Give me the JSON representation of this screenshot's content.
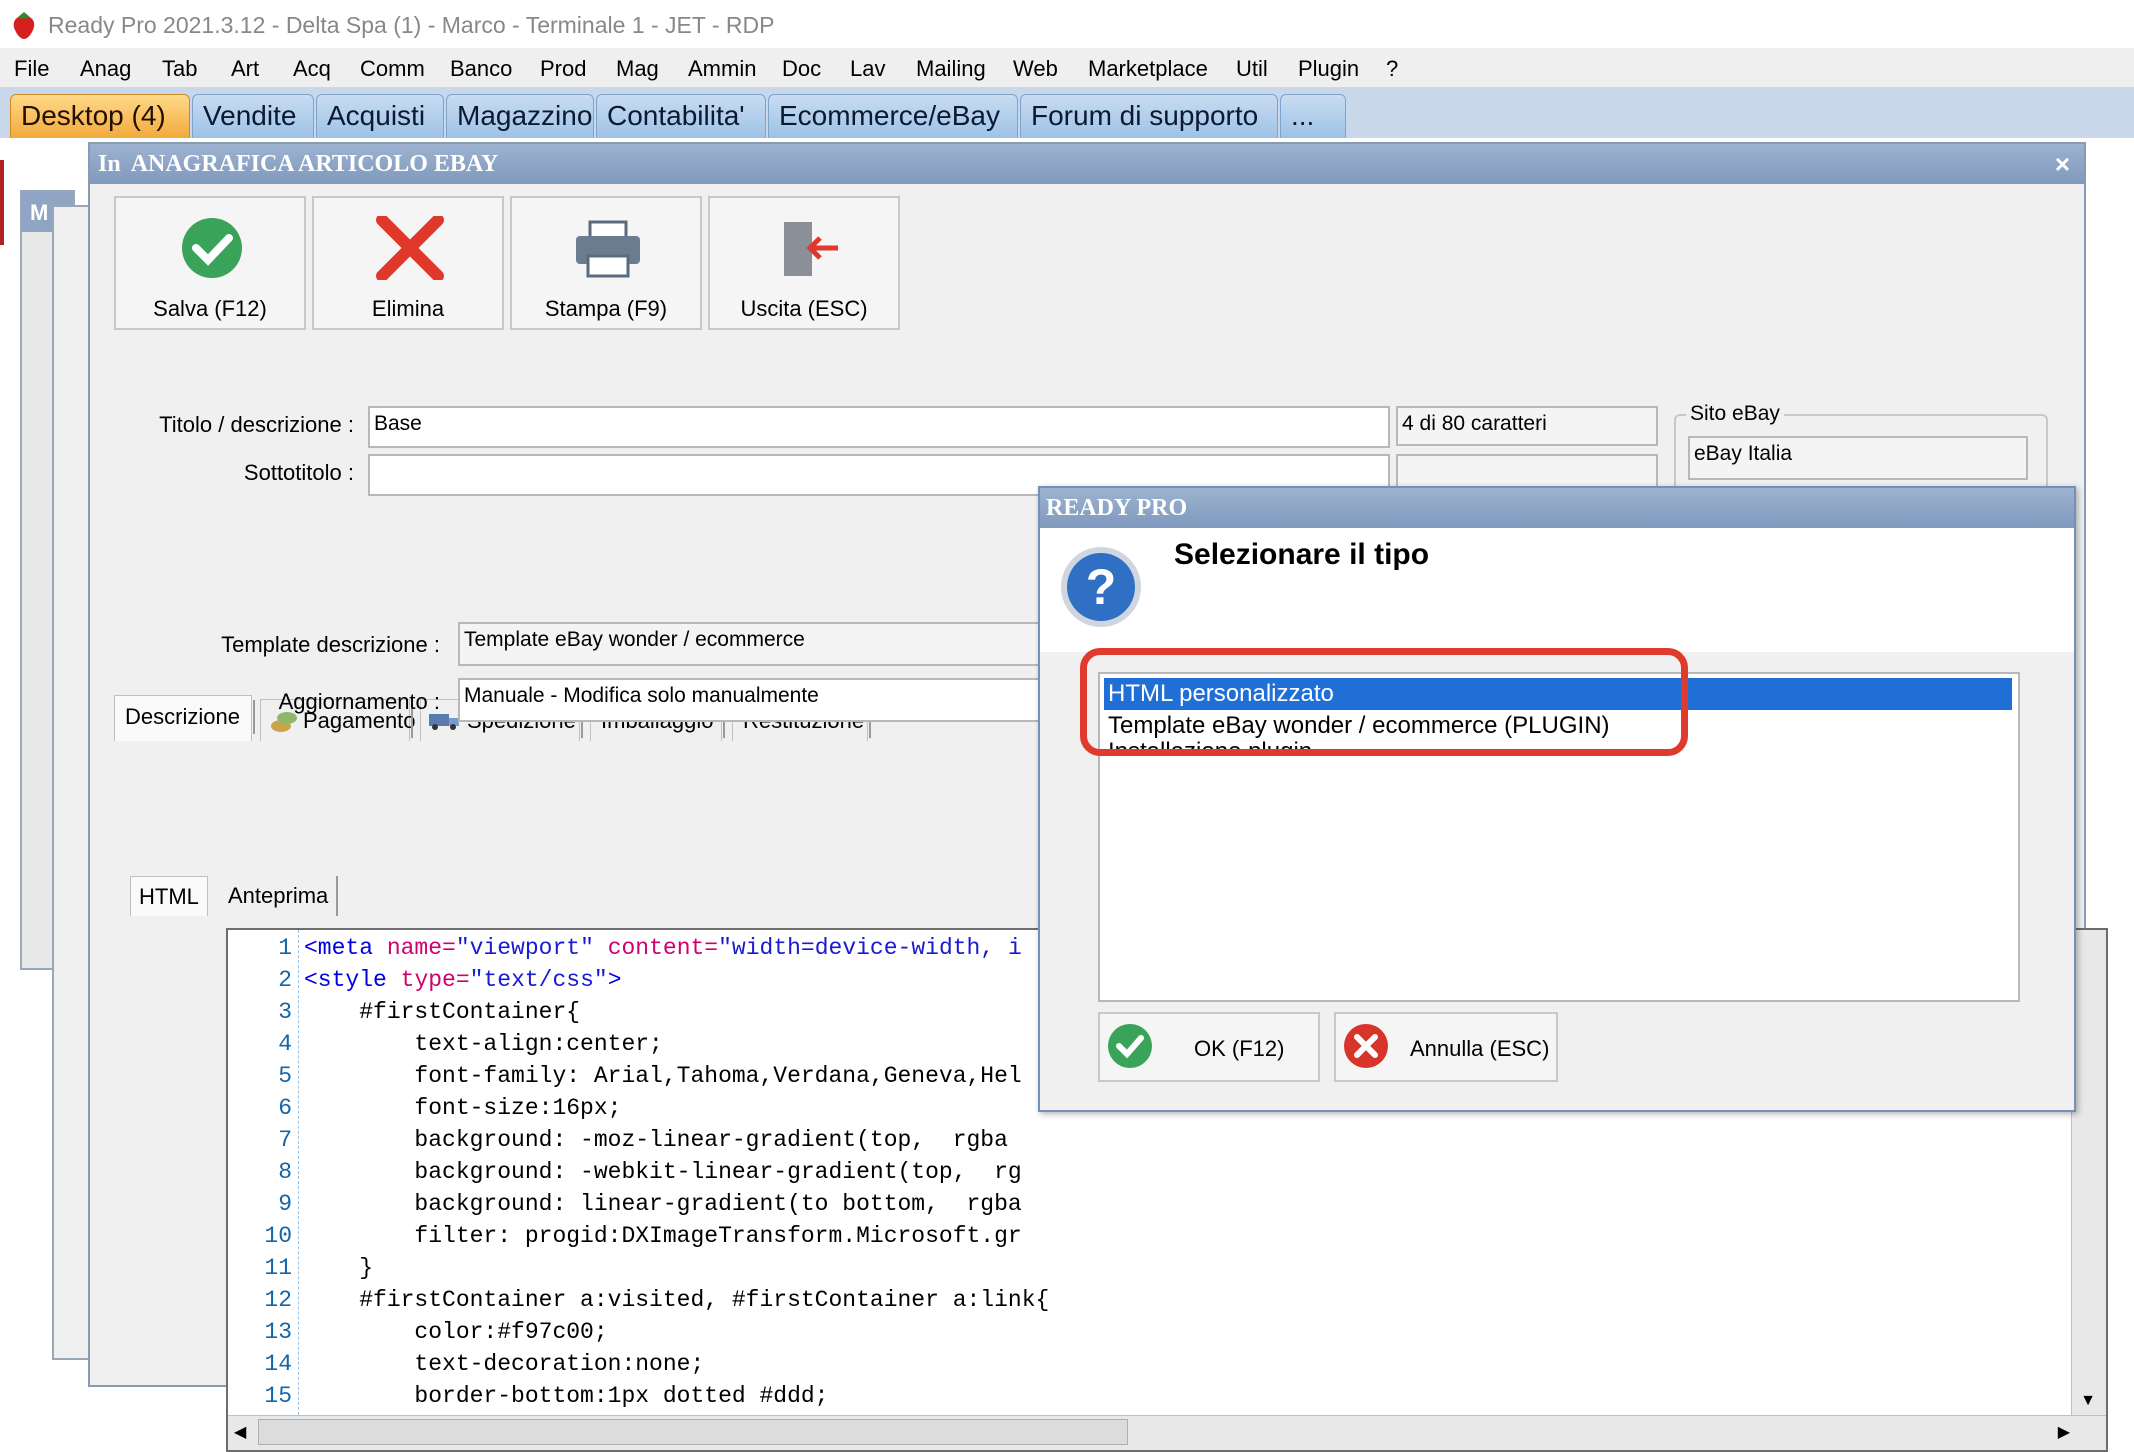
{
  "window": {
    "title": "Ready Pro 2021.3.12 - Delta Spa (1) - Marco - Terminale 1 - JET - RDP",
    "logo_icon": "strawberry-icon"
  },
  "menu": {
    "items": [
      "File",
      "Anag",
      "Tab",
      "Art",
      "Acq",
      "Comm",
      "Banco",
      "Prod",
      "Mag",
      "Ammin",
      "Doc",
      "Lav",
      "Mailing",
      "Web",
      "Marketplace",
      "Util",
      "Plugin",
      "?"
    ]
  },
  "desktop_tabs": {
    "items": [
      "Desktop (4)",
      "Vendite",
      "Acquisti",
      "Magazzino",
      "Contabilita'",
      "Ecommerce/eBay",
      "Forum di supporto",
      "..."
    ]
  },
  "background_windows": {
    "prefix_1": "In",
    "prefix_2": "M"
  },
  "article_window": {
    "title": "ANAGRAFICA ARTICOLO EBAY",
    "close_glyph": "×",
    "toolbar": {
      "save_label": "Salva (F12)",
      "delete_label": "Elimina",
      "print_label": "Stampa (F9)",
      "exit_label": "Uscita (ESC)"
    },
    "form": {
      "title_label": "Titolo / descrizione :",
      "title_value": "Base",
      "char_count": "4 di 80 caratteri",
      "subtitle_label": "Sottotitolo :",
      "subtitle_value": "",
      "site_group_label": "Sito eBay",
      "site_value": "eBay Italia"
    },
    "tabs": [
      "Descrizione",
      "Pagamento",
      "Spedizione",
      "Imballaggio",
      "Restituzione"
    ],
    "description": {
      "template_label": "Template descrizione :",
      "template_value": "Template eBay wonder / ecommerce",
      "update_label": "Aggiornamento :",
      "update_value": "Manuale - Modifica solo manualmente",
      "subtabs": [
        "HTML",
        "Anteprima"
      ]
    },
    "code_lines": [
      {
        "n": "1",
        "html": "<span class=\"tg\">&lt;meta</span> <span class=\"an\">name=</span><span class=\"av\">\"viewport\"</span> <span class=\"an\">content=</span><span class=\"av\">\"width=device-width, i</span>"
      },
      {
        "n": "2",
        "html": "<span class=\"tg\">&lt;style</span> <span class=\"an\">type=</span><span class=\"av\">\"text/css\"</span><span class=\"tg\">&gt;</span>"
      },
      {
        "n": "3",
        "html": "    #firstContainer{"
      },
      {
        "n": "4",
        "html": "        text-align:center;"
      },
      {
        "n": "5",
        "html": "        font-family: Arial,Tahoma,Verdana,Geneva,Hel"
      },
      {
        "n": "6",
        "html": "        font-size:16px;"
      },
      {
        "n": "7",
        "html": "        background: -moz-linear-gradient(top,  rgba"
      },
      {
        "n": "8",
        "html": "        background: -webkit-linear-gradient(top,  rg"
      },
      {
        "n": "9",
        "html": "        background: linear-gradient(to bottom,  rgba"
      },
      {
        "n": "10",
        "html": "        filter: progid:DXImageTransform.Microsoft.gr"
      },
      {
        "n": "11",
        "html": "    }"
      },
      {
        "n": "12",
        "html": "    #firstContainer a:visited, #firstContainer a:link{"
      },
      {
        "n": "13",
        "html": "        color:#f97c00;"
      },
      {
        "n": "14",
        "html": "        text-decoration:none;"
      },
      {
        "n": "15",
        "html": "        border-bottom:1px dotted #ddd;"
      }
    ]
  },
  "dialog": {
    "title": "READY PRO",
    "heading": "Selezionare il tipo",
    "options": [
      "HTML personalizzato",
      "Template eBay wonder / ecommerce (PLUGIN)",
      "Installazione plugin..."
    ],
    "selected_index": 0,
    "ok_label": "OK (F12)",
    "cancel_label": "Annulla (ESC)"
  },
  "colors": {
    "highlight": "#e03a2e",
    "selection": "#1f6fd6",
    "active_tab": "#f3a93a"
  }
}
